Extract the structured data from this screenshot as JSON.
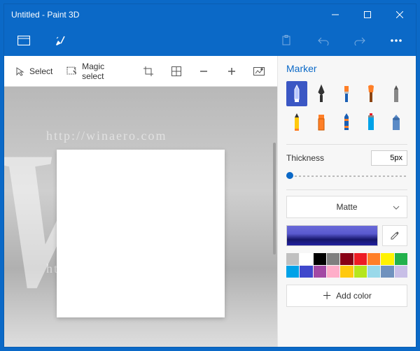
{
  "window": {
    "title": "Untitled - Paint 3D"
  },
  "toolbar": {
    "select": "Select",
    "magic_select": "Magic select"
  },
  "sidepanel": {
    "title": "Marker",
    "thickness_label": "Thickness",
    "thickness_value": "5px",
    "material": "Matte",
    "add_color": "Add color",
    "tools": [
      "marker",
      "calligraphy-pen",
      "oil-brush",
      "paint-brush",
      "pencil-tool",
      "pencil",
      "eraser",
      "crayon",
      "spray-can",
      "fill"
    ],
    "selected_tool": 0,
    "palette": [
      "#c0c0c0",
      "#ffffff",
      "#000000",
      "#7f7f7f",
      "#880015",
      "#ed1c24",
      "#ff7f27",
      "#fff200",
      "#22b14c",
      "#00a2e8",
      "#3f48cc",
      "#a349a4",
      "#ffaec9",
      "#ffc90e",
      "#b5e61d",
      "#99d9ea",
      "#7092be",
      "#c8bfe7"
    ]
  },
  "watermark": {
    "url": "http://winaero.com"
  }
}
